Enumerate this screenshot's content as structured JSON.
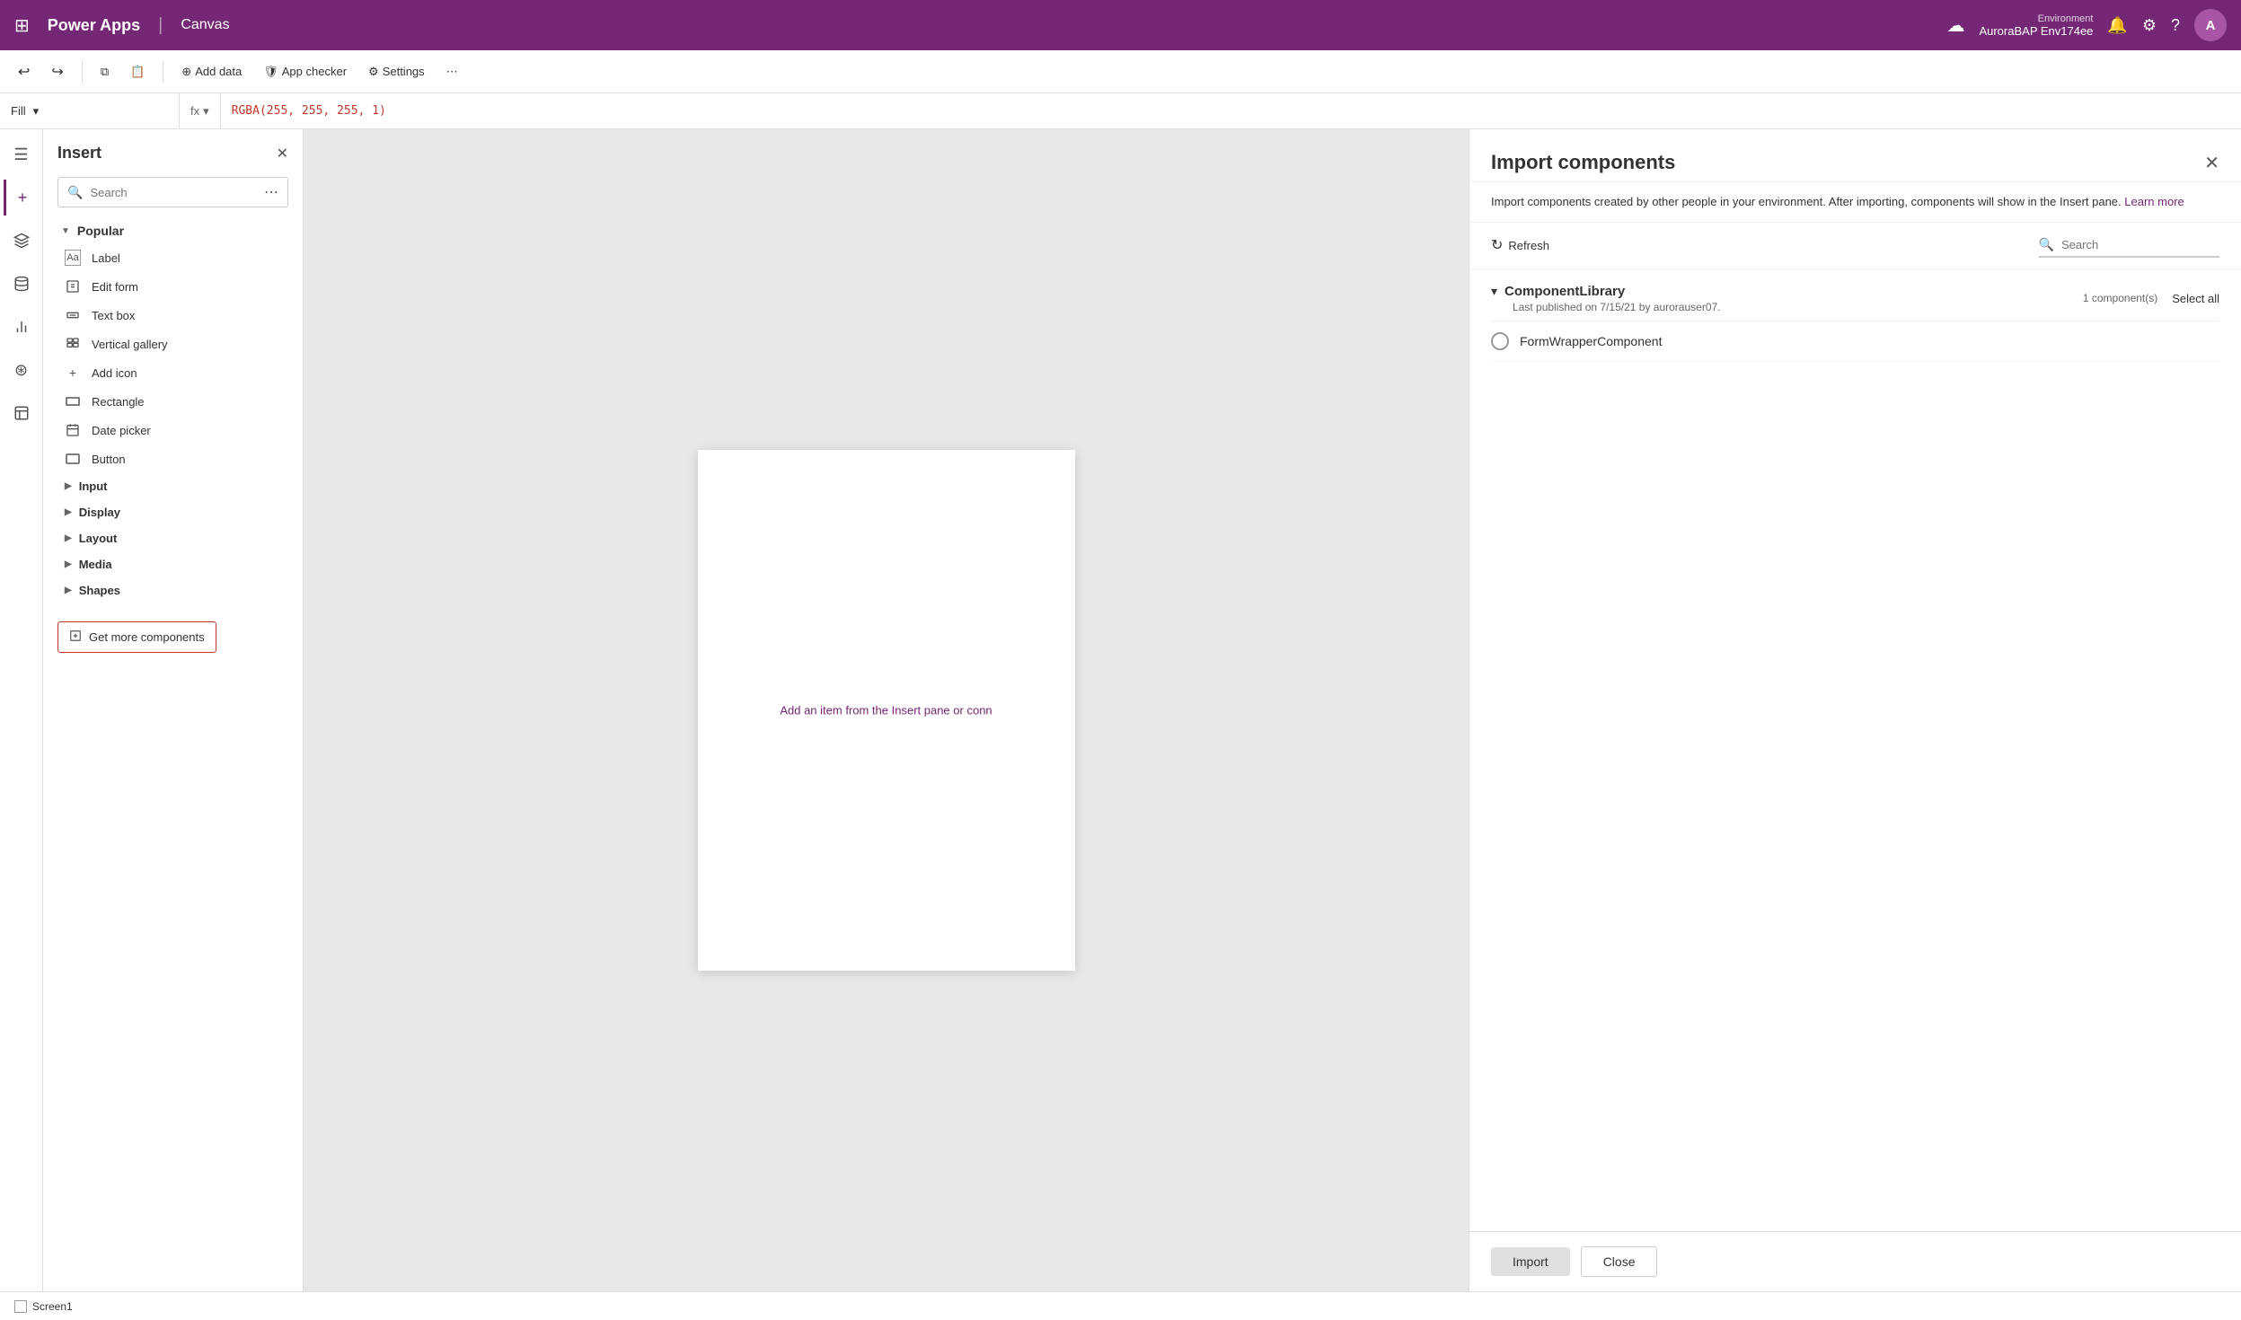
{
  "app": {
    "title": "Power Apps",
    "separator": "|",
    "subtitle": "Canvas"
  },
  "topbar": {
    "environment_label": "Environment",
    "environment_name": "AuroraBAP Env174ee",
    "avatar_text": "A"
  },
  "toolbar2": {
    "undo_label": "Undo",
    "redo_label": "Redo",
    "copy_label": "Copy",
    "paste_label": "Paste",
    "add_data_label": "Add data",
    "app_checker_label": "App checker",
    "settings_label": "Settings"
  },
  "formulabar": {
    "property": "Fill",
    "fx_label": "fx",
    "formula": "RGBA(255, 255, 255, 1)"
  },
  "insert_panel": {
    "title": "Insert",
    "search_placeholder": "Search",
    "categories": {
      "popular": "Popular",
      "input": "Input",
      "display": "Display",
      "layout": "Layout",
      "media": "Media",
      "shapes": "Shapes"
    },
    "items": [
      {
        "label": "Label",
        "icon": "🏷"
      },
      {
        "label": "Edit form",
        "icon": "📝"
      },
      {
        "label": "Text box",
        "icon": "T"
      },
      {
        "label": "Vertical gallery",
        "icon": "▦"
      },
      {
        "label": "Add icon",
        "icon": "+"
      },
      {
        "label": "Rectangle",
        "icon": "▭"
      },
      {
        "label": "Date picker",
        "icon": "📅"
      },
      {
        "label": "Button",
        "icon": "⬛"
      }
    ]
  },
  "canvas": {
    "hint_text": "Add an item from the Insert pane",
    "hint_link": "or conn"
  },
  "import_panel": {
    "title": "Import components",
    "description": "Import components created by other people in your environment. After importing, components will show in the Insert pane.",
    "learn_more_text": "Learn more",
    "refresh_label": "Refresh",
    "search_placeholder": "Search",
    "library_name": "ComponentLibrary",
    "library_meta": "Last published on 7/15/21 by aurorauser07.",
    "component_count": "1 component(s)",
    "select_all_label": "Select all",
    "component_name": "FormWrapperComponent",
    "import_btn_label": "Import",
    "close_btn_label": "Close"
  },
  "statusbar": {
    "screen_label": "Screen1"
  },
  "get_more": {
    "label": "Get more components"
  }
}
